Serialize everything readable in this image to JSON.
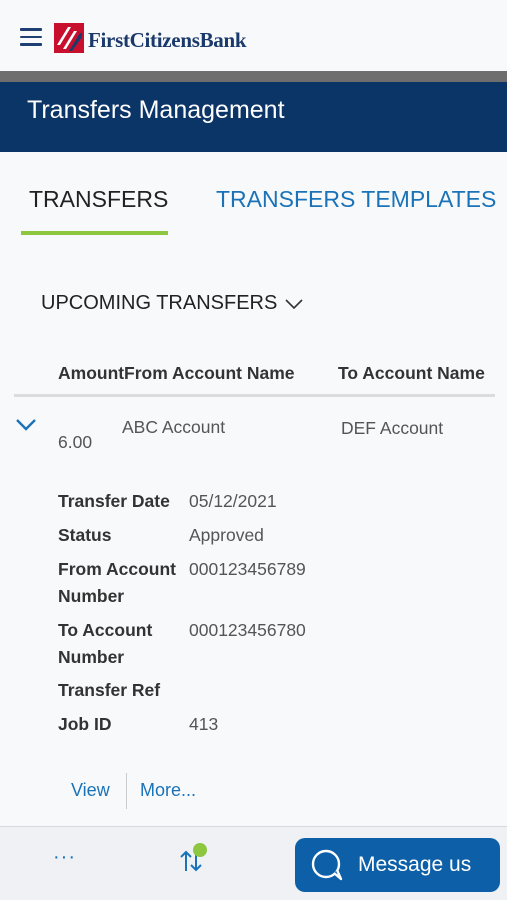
{
  "brand": {
    "name": "FirstCitizensBank"
  },
  "header": {
    "title": "Transfers Management"
  },
  "tabs": [
    {
      "label": "TRANSFERS",
      "active": true
    },
    {
      "label": "TRANSFERS TEMPLATES",
      "active": false
    }
  ],
  "filter": {
    "label": "UPCOMING TRANSFERS"
  },
  "table": {
    "columns": [
      "Amount",
      "From Account Name",
      "To Account Name"
    ],
    "rows": [
      {
        "amount": "6.00",
        "from_account": "ABC Account",
        "to_account": "DEF Account"
      }
    ]
  },
  "details": [
    {
      "label": "Transfer Date",
      "value": "05/12/2021"
    },
    {
      "label": "Status",
      "value": "Approved"
    },
    {
      "label": "From Account Number",
      "value": "000123456789"
    },
    {
      "label": "To Account Number",
      "value": "000123456780"
    },
    {
      "label": "Transfer Ref",
      "value": ""
    },
    {
      "label": "Job ID",
      "value": "413"
    }
  ],
  "actions": {
    "view": "View",
    "more": "More..."
  },
  "bottom": {
    "more_dots": "···",
    "message_label": "Message us"
  },
  "colors": {
    "navy": "#0b3467",
    "accent_green": "#8dc63f",
    "link_blue": "#1a73b8",
    "button_blue": "#0d5fa8"
  }
}
